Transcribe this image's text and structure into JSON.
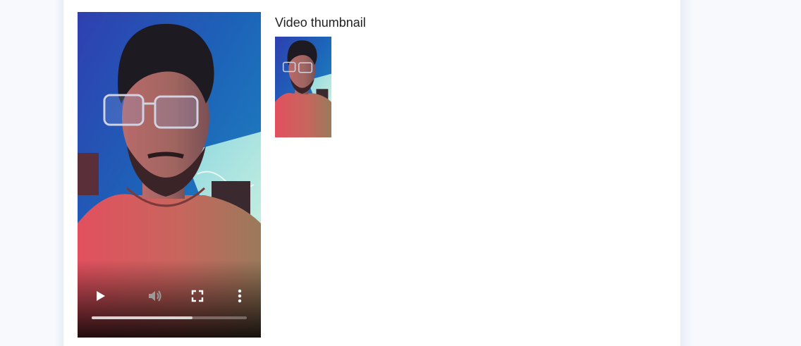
{
  "thumbnail_section": {
    "heading": "Video thumbnail"
  },
  "video_player": {
    "progress_fraction": 0.65,
    "controls": {
      "play_icon": "play-icon",
      "volume_icon": "volume-icon",
      "fullscreen_icon": "fullscreen-icon",
      "more_icon": "more-vertical-icon"
    }
  },
  "colors": {
    "page_background": "#f7f9fd",
    "card_background": "#ffffff",
    "heading_text": "#222222",
    "controls": "#ffffff"
  }
}
